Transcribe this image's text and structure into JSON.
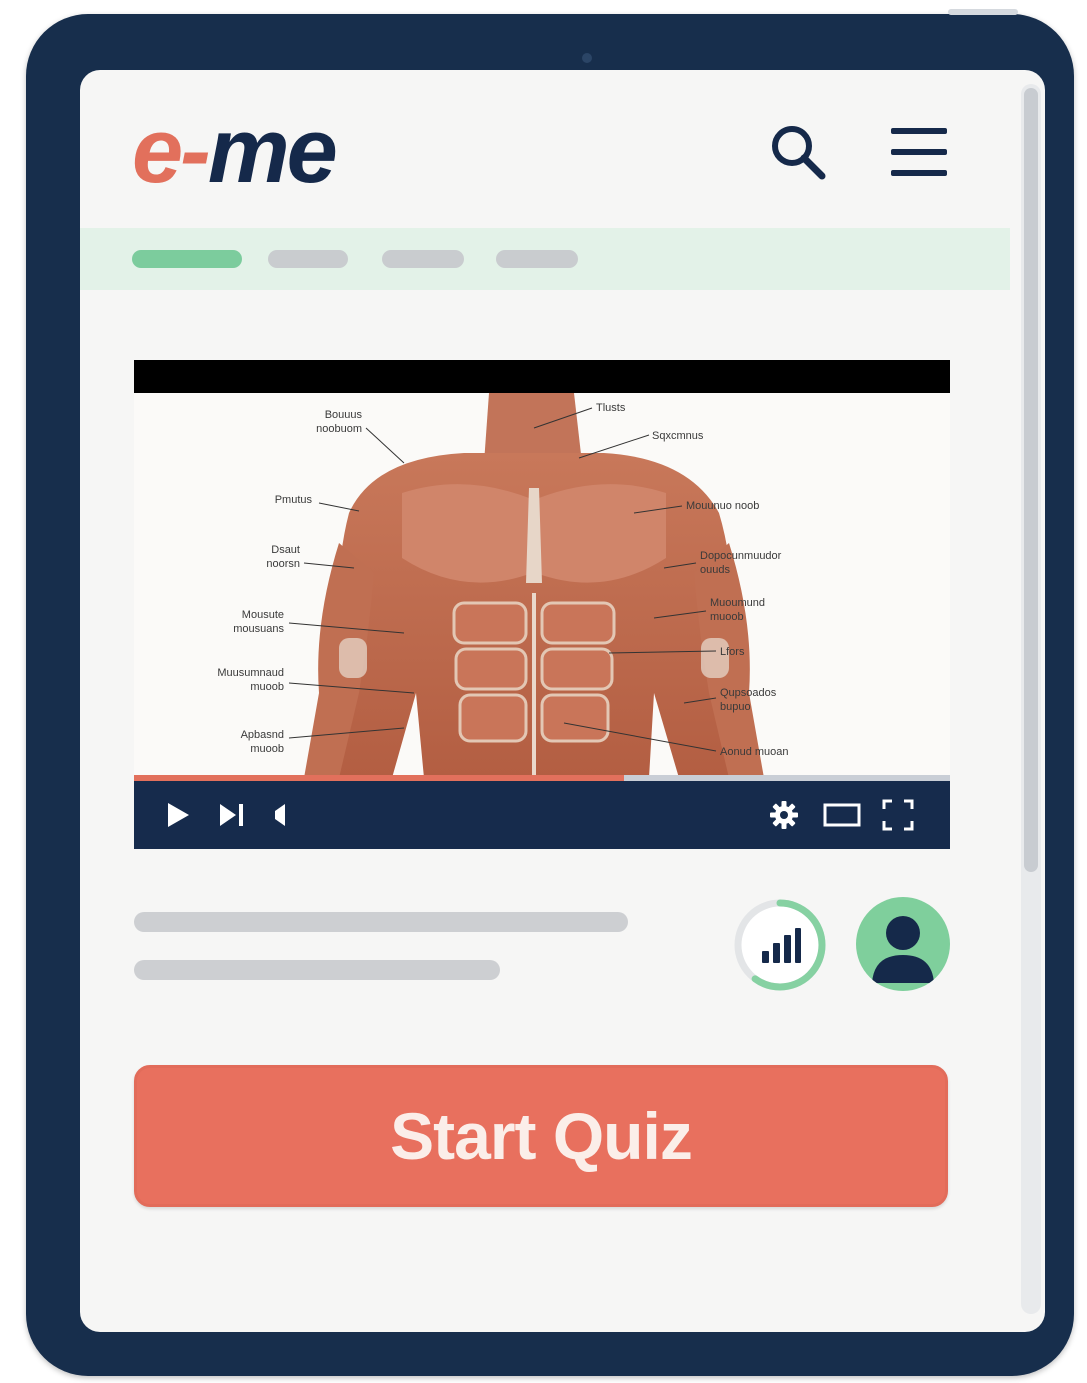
{
  "app": {
    "logo_prefix": "e-",
    "logo_suffix": "me"
  },
  "header": {
    "search_icon": "search-icon",
    "menu_icon": "hamburger-menu-icon"
  },
  "tabs": [
    {
      "state": "active"
    },
    {
      "state": "inactive"
    },
    {
      "state": "inactive"
    },
    {
      "state": "inactive"
    }
  ],
  "video": {
    "subject": "anatomical illustration of human torso muscles",
    "playback_progress": 0.6,
    "controls": [
      "play-icon",
      "skip-next-icon",
      "volume-icon",
      "gear-icon",
      "theater-mode-icon",
      "fullscreen-icon"
    ],
    "labels_left": [
      "Bouuus\nnoobuom",
      "Pmutus",
      "Dsaut\nnoorsn",
      "Mousute\nmousuans",
      "Muusumnaud\nmuoob",
      "Apbasnd\nmuoob"
    ],
    "labels_right": [
      "Tlusts",
      "Sqxcmnus",
      "Mouunuo noob",
      "Dopocunmuudor\nouuds",
      "Muoumund\nmuoob",
      "Lfors",
      "Qupsoados\nbupuo",
      "Aonud muoan"
    ]
  },
  "stats": {
    "icon": "bar-chart-icon",
    "ring_progress": 0.6
  },
  "profile": {
    "icon": "user-avatar-icon"
  },
  "cta": {
    "label": "Start Quiz"
  },
  "colors": {
    "brand_coral": "#e8705e",
    "brand_navy": "#15294a",
    "accent_green": "#7ccc9d"
  }
}
